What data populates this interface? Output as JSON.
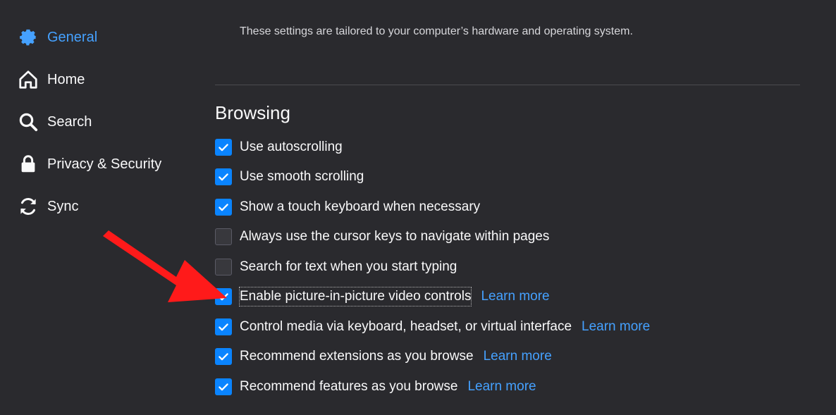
{
  "sidebar": {
    "items": [
      {
        "label": "General",
        "icon": "gear-icon",
        "active": true
      },
      {
        "label": "Home",
        "icon": "home-icon",
        "active": false
      },
      {
        "label": "Search",
        "icon": "search-icon",
        "active": false
      },
      {
        "label": "Privacy & Security",
        "icon": "lock-icon",
        "active": false
      },
      {
        "label": "Sync",
        "icon": "sync-icon",
        "active": false
      }
    ]
  },
  "main": {
    "hint": "These settings are tailored to your computer’s hardware and operating system.",
    "section_title": "Browsing",
    "learn_more_label": "Learn more",
    "options": [
      {
        "label": "Use autoscrolling",
        "checked": true,
        "learn_more": false
      },
      {
        "label": "Use smooth scrolling",
        "checked": true,
        "learn_more": false
      },
      {
        "label": "Show a touch keyboard when necessary",
        "checked": true,
        "learn_more": false
      },
      {
        "label": "Always use the cursor keys to navigate within pages",
        "checked": false,
        "learn_more": false
      },
      {
        "label": "Search for text when you start typing",
        "checked": false,
        "learn_more": false
      },
      {
        "label": "Enable picture-in-picture video controls",
        "checked": true,
        "learn_more": true,
        "focused": true
      },
      {
        "label": "Control media via keyboard, headset, or virtual interface",
        "checked": true,
        "learn_more": true
      },
      {
        "label": "Recommend extensions as you browse",
        "checked": true,
        "learn_more": true
      },
      {
        "label": "Recommend features as you browse",
        "checked": true,
        "learn_more": true
      }
    ]
  },
  "colors": {
    "background": "#2a2a2e",
    "accent": "#45a1ff",
    "checkbox_checked": "#0a84ff",
    "annotation_arrow": "#ff1a1a"
  }
}
